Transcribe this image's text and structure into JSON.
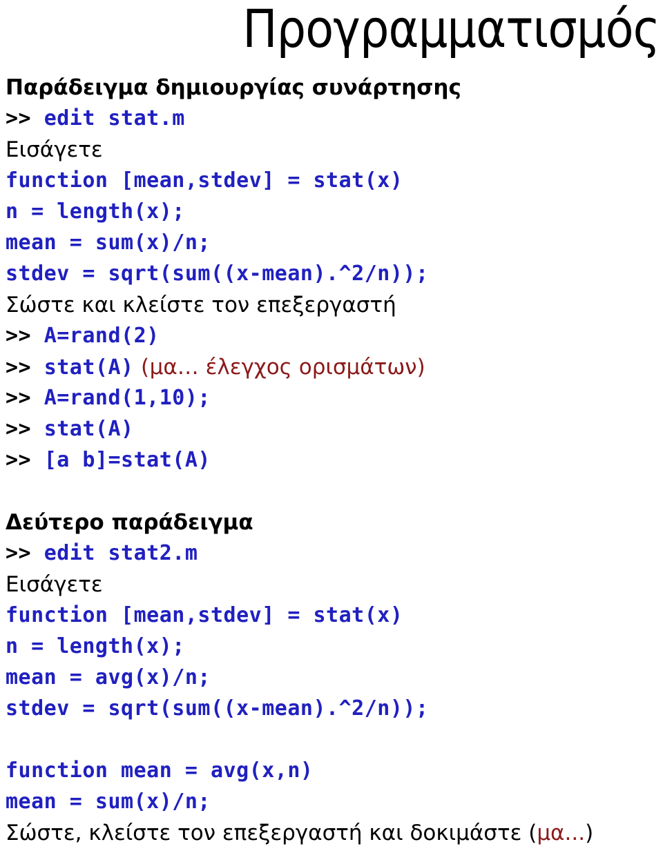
{
  "title": "Προγραμματισμός",
  "colors": {
    "code_blue": "#2020C0",
    "annotation_red": "#8B1A1A",
    "text_black": "#000000",
    "background": "#ffffff"
  },
  "prompt_symbol": ">>",
  "sections": [
    {
      "heading": "Παράδειγμα δημιουργίας συνάρτησης",
      "lines": [
        {
          "kind": "command",
          "prompt": ">>",
          "code": "edit stat.m"
        },
        {
          "kind": "prose",
          "text": "Εισάγετε"
        },
        {
          "kind": "code",
          "code": "function [mean,stdev] = stat(x)"
        },
        {
          "kind": "code",
          "code": "n = length(x);"
        },
        {
          "kind": "code",
          "code": "mean = sum(x)/n;"
        },
        {
          "kind": "code",
          "code": "stdev = sqrt(sum((x-mean).^2/n));"
        },
        {
          "kind": "prose",
          "text": "Σώστε και κλείστε τον επεξεργαστή"
        },
        {
          "kind": "command",
          "prompt": ">>",
          "code": "A=rand(2)"
        },
        {
          "kind": "command-annot",
          "prompt": ">>",
          "code": "stat(A)",
          "open_paren": "(",
          "annotation": "μα… έλεγχος ορισμάτων",
          "close_paren": ")"
        },
        {
          "kind": "command",
          "prompt": ">>",
          "code": "A=rand(1,10);"
        },
        {
          "kind": "command",
          "prompt": ">>",
          "code": "stat(A)"
        },
        {
          "kind": "command",
          "prompt": ">>",
          "code": "[a b]=stat(A)"
        }
      ]
    },
    {
      "heading": "Δεύτερο παράδειγμα",
      "lines": [
        {
          "kind": "command",
          "prompt": ">>",
          "code": "edit stat2.m"
        },
        {
          "kind": "prose",
          "text": "Εισάγετε"
        },
        {
          "kind": "code",
          "code": "function [mean,stdev] = stat(x)"
        },
        {
          "kind": "code",
          "code": "n = length(x);"
        },
        {
          "kind": "code",
          "code": "mean = avg(x)/n;"
        },
        {
          "kind": "code",
          "code": "stdev = sqrt(sum((x-mean).^2/n));"
        },
        {
          "kind": "blank"
        },
        {
          "kind": "code",
          "code": "function mean = avg(x,n)"
        },
        {
          "kind": "code",
          "code": "mean = sum(x)/n;"
        },
        {
          "kind": "prose-annot",
          "text": "Σώστε, κλείστε τον επεξεργαστή και δοκιμάστε ",
          "open_paren": "(",
          "annotation": "μα...",
          "close_paren": ")"
        }
      ]
    }
  ]
}
